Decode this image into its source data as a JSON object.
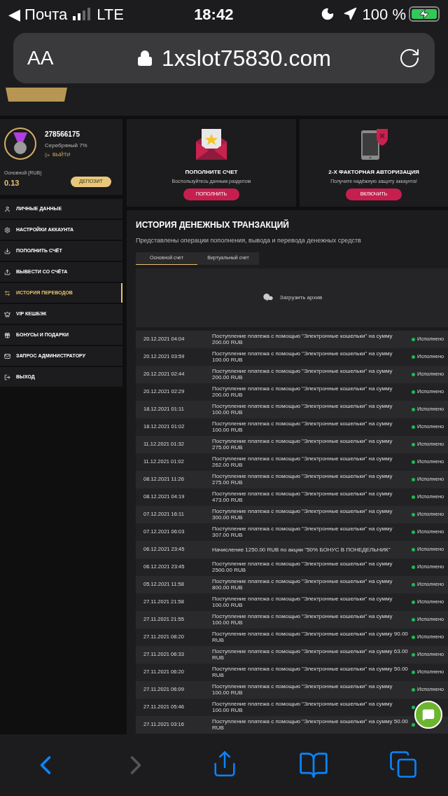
{
  "status_bar": {
    "back_app": "◀ Почта",
    "network": "LTE",
    "time": "18:42",
    "battery": "100 %",
    "charging": true
  },
  "browser": {
    "text_size": "AA",
    "url": "1xslot75830.com"
  },
  "profile": {
    "id": "278566175",
    "level": "Серебряный 7%",
    "logout": "ВЫЙТИ",
    "balance_label": "Основной (RUB)",
    "balance": "0.13",
    "deposit_button": "ДЕПОЗИТ"
  },
  "sidebar": {
    "items": [
      {
        "label": "ЛИЧНЫЕ ДАННЫЕ",
        "kind": "user",
        "selected": false
      },
      {
        "label": "НАСТРОЙКИ АККАУНТА",
        "kind": "gears",
        "selected": false
      },
      {
        "label": "ПОПОЛНИТЬ СЧЁТ",
        "kind": "download",
        "selected": false
      },
      {
        "label": "ВЫВЕСТИ СО СЧЁТА",
        "kind": "upload",
        "selected": false
      },
      {
        "label": "ИСТОРИЯ ПЕРЕВОДОВ",
        "kind": "transfer",
        "selected": true
      },
      {
        "label": "VIP КЕШБЭК",
        "kind": "crown",
        "selected": false
      },
      {
        "label": "БОНУСЫ И ПОДАРКИ",
        "kind": "gift",
        "selected": false
      },
      {
        "label": "ЗАПРОС АДМИНИСТРАТОРУ",
        "kind": "mail",
        "selected": false
      },
      {
        "label": "ВЫХОД",
        "kind": "exit",
        "selected": false
      }
    ]
  },
  "promo_cards": [
    {
      "kind": "envelope",
      "title": "ПОПОЛНИТЕ СЧЕТ",
      "text": "Воспользуйтесь данным разделом",
      "button": "ПОПОЛНИТЬ"
    },
    {
      "kind": "phone",
      "title": "2-Х ФАКТОРНАЯ АВТОРИЗАЦИЯ",
      "text": "Получите надёжную защиту аккаунта!",
      "button": "ВКЛЮЧИТЬ"
    }
  ],
  "history": {
    "title": "ИСТОРИЯ ДЕНЕЖНЫХ ТРАНЗАКЦИЙ",
    "subtitle": "Представлены операции пополнения, вывода и перевода денежных средств",
    "tabs": [
      {
        "label": "Основной счет",
        "selected": true
      },
      {
        "label": "Виртуальный счет",
        "selected": false
      }
    ],
    "archive_button": "Загрузить архив",
    "rows": [
      {
        "date": "20.12.2021 04:04",
        "description": "Поступление платежа с помощью \"Электронные кошельки\" на сумму 200.00 RUB",
        "status": "Исполнено",
        "color": "#1fb954"
      },
      {
        "date": "20.12.2021 03:59",
        "description": "Поступление платежа с помощью \"Электронные кошельки\" на сумму 100.00 RUB",
        "status": "Исполнено",
        "color": "#1fb954"
      },
      {
        "date": "20.12.2021 02:44",
        "description": "Поступление платежа с помощью \"Электронные кошельки\" на сумму 200.00 RUB",
        "status": "Исполнено",
        "color": "#1fb954"
      },
      {
        "date": "20.12.2021 02:29",
        "description": "Поступление платежа с помощью \"Электронные кошельки\" на сумму 200.00 RUB",
        "status": "Исполнено",
        "color": "#1fb954"
      },
      {
        "date": "18.12.2021 01:11",
        "description": "Поступление платежа с помощью \"Электронные кошельки\" на сумму 100.00 RUB",
        "status": "Исполнено",
        "color": "#1fb954"
      },
      {
        "date": "18.12.2021 01:02",
        "description": "Поступление платежа с помощью \"Электронные кошельки\" на сумму 100.00 RUB",
        "status": "Исполнено",
        "color": "#1fb954"
      },
      {
        "date": "11.12.2021 01:32",
        "description": "Поступление платежа с помощью \"Электронные кошельки\" на сумму 275.00 RUB",
        "status": "Исполнено",
        "color": "#1fb954"
      },
      {
        "date": "11.12.2021 01:02",
        "description": "Поступление платежа с помощью \"Электронные кошельки\" на сумму 262.00 RUB",
        "status": "Исполнено",
        "color": "#1fb954"
      },
      {
        "date": "08.12.2021 11:26",
        "description": "Поступление платежа с помощью \"Электронные кошельки\" на сумму 275.00 RUB",
        "status": "Исполнено",
        "color": "#1fb954"
      },
      {
        "date": "08.12.2021 04:19",
        "description": "Поступление платежа с помощью \"Электронные кошельки\" на сумму 473.00 RUB",
        "status": "Исполнено",
        "color": "#1fb954"
      },
      {
        "date": "07.12.2021 16:11",
        "description": "Поступление платежа с помощью \"Электронные кошельки\" на сумму 300.00 RUB",
        "status": "Исполнено",
        "color": "#1fb954"
      },
      {
        "date": "07.12.2021 06:03",
        "description": "Поступление платежа с помощью \"Электронные кошельки\" на сумму 307.00 RUB",
        "status": "Исполнено",
        "color": "#1fb954"
      },
      {
        "date": "06.12.2021 23:45",
        "description": "Начисление 1250.00 RUB по акции \"50% БОНУС В ПОНЕДЕЛЬНИК\"",
        "status": "Исполнено",
        "color": "#1fb954"
      },
      {
        "date": "06.12.2021 23:45",
        "description": "Поступление платежа с помощью \"Электронные кошельки\" на сумму 2500.00 RUB",
        "status": "Исполнено",
        "color": "#1fb954"
      },
      {
        "date": "05.12.2021 11:58",
        "description": "Поступление платежа с помощью \"Электронные кошельки\" на сумму 800.00 RUB",
        "status": "Исполнено",
        "color": "#1fb954"
      },
      {
        "date": "27.11.2021 21:58",
        "description": "Поступление платежа с помощью \"Электронные кошельки\" на сумму 100.00 RUB",
        "status": "Исполнено",
        "color": "#1fb954"
      },
      {
        "date": "27.11.2021 21:55",
        "description": "Поступление платежа с помощью \"Электронные кошельки\" на сумму 100.00 RUB",
        "status": "Исполнено",
        "color": "#1fb954"
      },
      {
        "date": "27.11.2021 08:20",
        "description": "Поступление платежа с помощью \"Электронные кошельки\" на сумму 90.00 RUB",
        "status": "Исполнено",
        "color": "#1fb954"
      },
      {
        "date": "27.11.2021 06:33",
        "description": "Поступление платежа с помощью \"Электронные кошельки\" на сумму 63.00 RUB",
        "status": "Исполнено",
        "color": "#1fb954"
      },
      {
        "date": "27.11.2021 06:20",
        "description": "Поступление платежа с помощью \"Электронные кошельки\" на сумму 50.00 RUB",
        "status": "Исполнено",
        "color": "#1fb954"
      },
      {
        "date": "27.11.2021 06:09",
        "description": "Поступление платежа с помощью \"Электронные кошельки\" на сумму 100.00 RUB",
        "status": "Исполнено",
        "color": "#1fb954"
      },
      {
        "date": "27.11.2021 05:46",
        "description": "Поступление платежа с помощью \"Электронные кошельки\" на сумму 100.00 RUB",
        "color": "#1fb954"
      },
      {
        "date": "27.11.2021 03:16",
        "description": "Поступление платежа с помощью \"Электронные кошельки\" на сумму 50.00 RUB",
        "color": "#1fb954"
      }
    ]
  },
  "toolbar": {
    "forward_disabled": true
  }
}
